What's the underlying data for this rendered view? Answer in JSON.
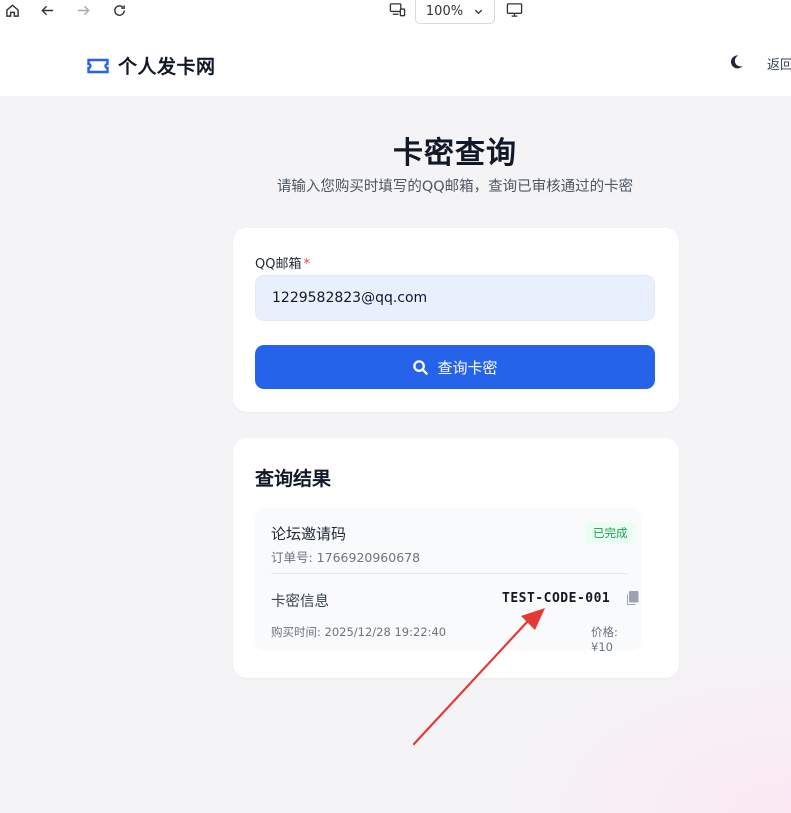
{
  "browser": {
    "zoom": "100%",
    "icons": [
      "home-icon",
      "back-icon",
      "forward-icon",
      "reload-icon",
      "device-mode-icon",
      "chevron-down-icon",
      "cast-icon"
    ]
  },
  "header": {
    "brand": "个人发卡网",
    "back_link": "返回"
  },
  "page": {
    "title": "卡密查询",
    "subtitle": "请输入您购买时填写的QQ邮箱，查询已审核通过的卡密"
  },
  "form": {
    "email_label": "QQ邮箱",
    "required_mark": "*",
    "email_value": "1229582823@qq.com",
    "submit_label": "查询卡密"
  },
  "result": {
    "title": "查询结果",
    "item": {
      "product": "论坛邀请码",
      "order_label": "订单号: 1766920960678",
      "status": "已完成",
      "kami_label": "卡密信息",
      "kami_code": "TEST-CODE-001",
      "buy_time": "购买时间: 2025/12/28 19:22:40",
      "price": "价格: ¥10"
    }
  },
  "colors": {
    "primary": "#2563eb",
    "success": "#16a34a",
    "annotation_arrow": "#e53935"
  }
}
